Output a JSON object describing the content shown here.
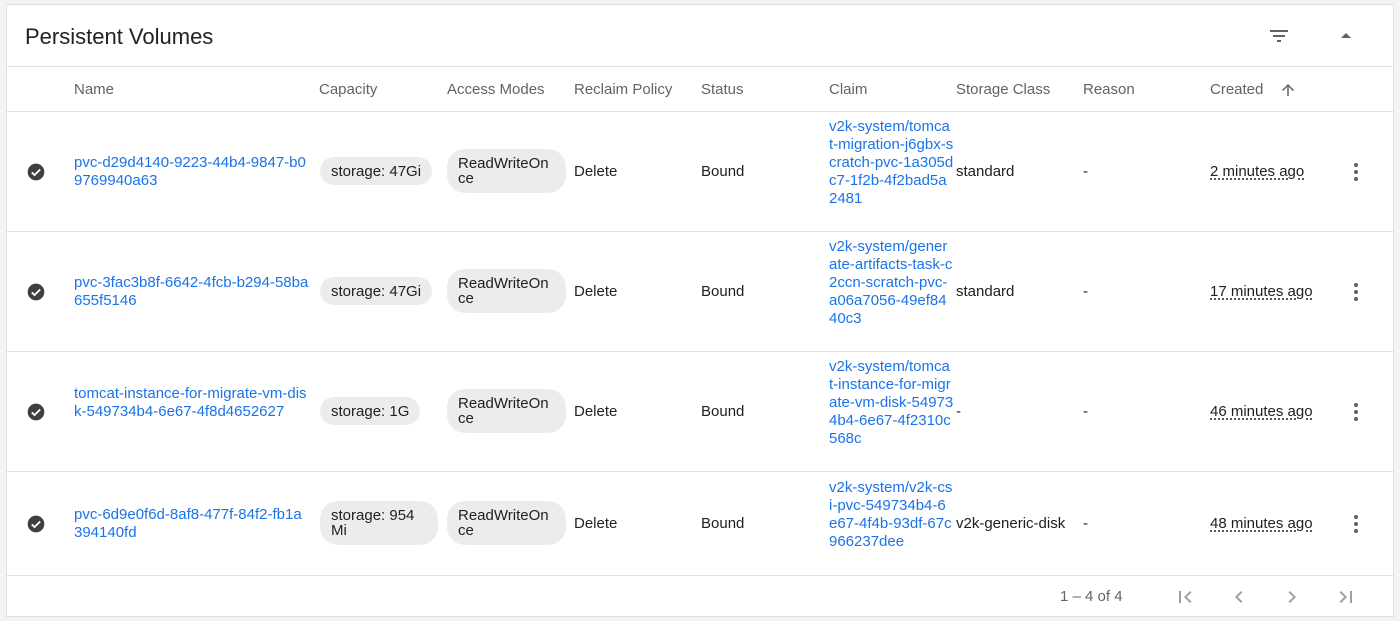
{
  "title": "Persistent Volumes",
  "columns": {
    "name": "Name",
    "capacity": "Capacity",
    "access_modes": "Access Modes",
    "reclaim_policy": "Reclaim Policy",
    "status": "Status",
    "claim": "Claim",
    "storage_class": "Storage Class",
    "reason": "Reason",
    "created": "Created"
  },
  "icons": {
    "filter": "filter-list-icon",
    "collapse": "expand-less-icon",
    "sort": "arrow-upward-icon",
    "status": "check-circle-icon",
    "row_menu": "more-vert-icon",
    "first_page": "first-page-icon",
    "prev_page": "chevron-left-icon",
    "next_page": "chevron-right-icon",
    "last_page": "last-page-icon"
  },
  "colors": {
    "link": "#1a73e8",
    "status_ok": "#3c4043"
  },
  "rows": [
    {
      "name": "pvc-d29d4140-9223-44b4-9847-b09769940a63",
      "capacity": "storage: 47Gi",
      "access_mode": "ReadWriteOnce",
      "reclaim_policy": "Delete",
      "status": "Bound",
      "claim": "v2k-system/tomcat-migration-j6gbx-scratch-pvc-1a305dc7-1f2b-4f2bad5a2481",
      "storage_class": "standard",
      "reason": "-",
      "created": "2 minutes ago"
    },
    {
      "name": "pvc-3fac3b8f-6642-4fcb-b294-58ba655f5146",
      "capacity": "storage: 47Gi",
      "access_mode": "ReadWriteOnce",
      "reclaim_policy": "Delete",
      "status": "Bound",
      "claim": "v2k-system/generate-artifacts-task-c2ccn-scratch-pvc-a06a7056-49ef8440c3",
      "storage_class": "standard",
      "reason": "-",
      "created": "17 minutes ago"
    },
    {
      "name": "tomcat-instance-for-migrate-vm-disk-549734b4-6e67-4f8d4652627",
      "capacity": "storage: 1G",
      "access_mode": "ReadWriteOnce",
      "reclaim_policy": "Delete",
      "status": "Bound",
      "claim": "v2k-system/tomcat-instance-for-migrate-vm-disk-549734b4-6e67-4f2310c568c",
      "storage_class": "-",
      "reason": "-",
      "created": "46 minutes ago"
    },
    {
      "name": "pvc-6d9e0f6d-8af8-477f-84f2-fb1a394140fd",
      "capacity": "storage: 954 Mi",
      "access_mode": "ReadWriteOnce",
      "reclaim_policy": "Delete",
      "status": "Bound",
      "claim": "v2k-system/v2k-csi-pvc-549734b4-6e67-4f4b-93df-67c966237dee",
      "storage_class": "v2k-generic-disk",
      "reason": "-",
      "created": "48 minutes ago"
    }
  ],
  "pagination": {
    "range_label": "1 – 4 of 4"
  }
}
